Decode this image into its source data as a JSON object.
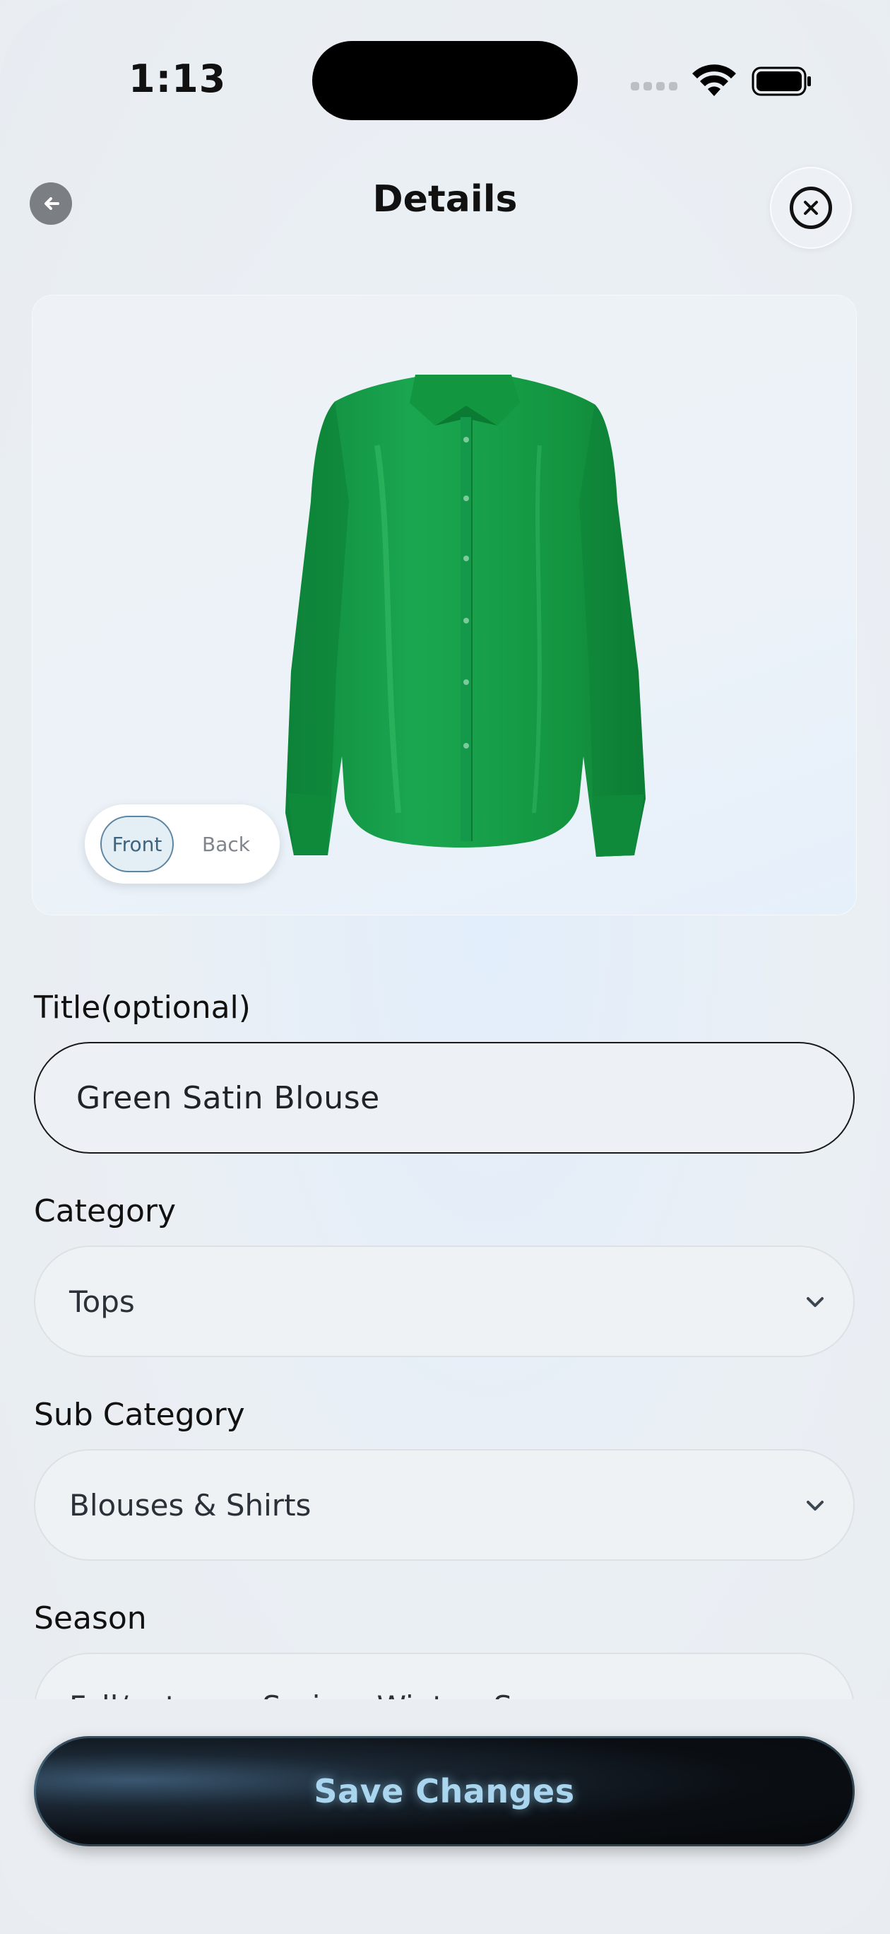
{
  "status_bar": {
    "time": "1:13"
  },
  "header": {
    "title": "Details"
  },
  "image_toggle": {
    "front_label": "Front",
    "back_label": "Back",
    "selected": "Front"
  },
  "form": {
    "title_label": "Title(optional)",
    "title_value": "Green Satin Blouse",
    "category_label": "Category",
    "category_value": "Tops",
    "subcategory_label": "Sub Category",
    "subcategory_value": "Blouses & Shirts",
    "season_label": "Season",
    "season_value": "Fall/autumn, Spring, Winter, Summer"
  },
  "actions": {
    "save_label": "Save Changes"
  },
  "colors": {
    "garment": "#17a049",
    "button_bg": "#0b0f14",
    "button_text": "#a9d6ee"
  },
  "icons": [
    "back-arrow-icon",
    "close-icon",
    "wifi-icon",
    "battery-icon",
    "chevron-down-icon"
  ]
}
